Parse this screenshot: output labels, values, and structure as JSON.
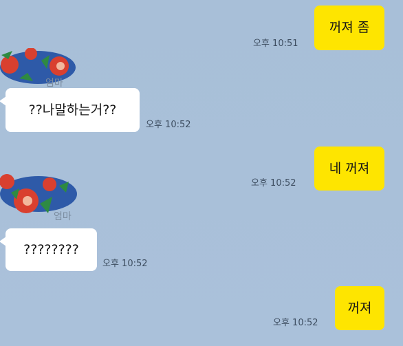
{
  "chat": {
    "messages": [
      {
        "side": "me",
        "text": "꺼져 좀",
        "time": "오후 10:51"
      },
      {
        "side": "other",
        "text": "??나말하는거??",
        "time": "오후 10:52"
      },
      {
        "side": "me",
        "text": "네 꺼져",
        "time": "오후 10:52"
      },
      {
        "side": "other",
        "text": "????????",
        "time": "오후 10:52"
      },
      {
        "side": "me",
        "text": "꺼져",
        "time": "오후 10:52"
      }
    ]
  },
  "sender": {
    "name": "엄마"
  },
  "colors": {
    "background": "#a9c0d8",
    "my_bubble": "#fee500",
    "their_bubble": "#ffffff",
    "avatar_blue": "#2e5aa8",
    "avatar_red": "#d9402f",
    "avatar_green": "#2e8a42"
  }
}
